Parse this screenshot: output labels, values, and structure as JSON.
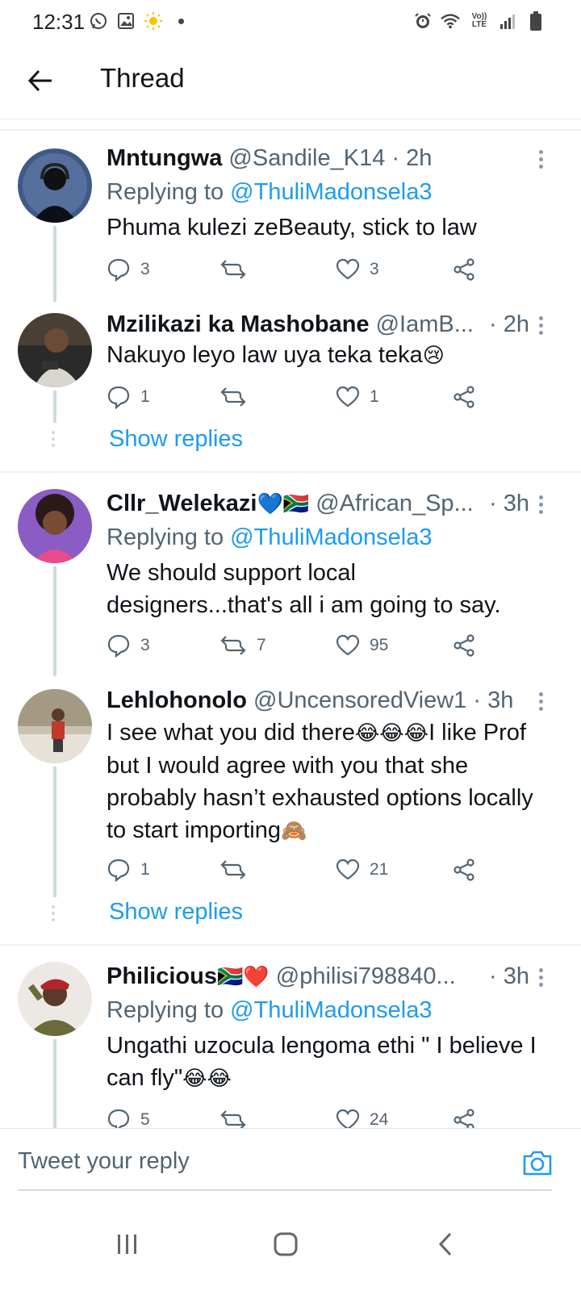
{
  "status_bar": {
    "time": "12:31",
    "lte_label": "Vo)) LTE"
  },
  "header": {
    "title": "Thread"
  },
  "tweets": [
    {
      "name": "Mntungwa",
      "handle": "@Sandile_K14",
      "time": "· 2h",
      "replying_label": "Replying to",
      "replying_to": "@ThuliMadonsela3",
      "text": "Phuma kulezi zeBeauty, stick to law",
      "replies": "3",
      "retweets": "",
      "likes": "3"
    },
    {
      "name": "Mzilikazi ka Mashobane",
      "handle": "@IamB...",
      "time": "· 2h",
      "text": "Nakuyo leyo law uya teka teka",
      "emoji": "😢",
      "replies": "1",
      "retweets": "",
      "likes": "1",
      "show_replies": "Show replies"
    },
    {
      "name": "Cllr_Welekazi",
      "name_emoji": "💙🇿🇦",
      "handle": "@African_Sp...",
      "time": "· 3h",
      "replying_label": "Replying to",
      "replying_to": "@ThuliMadonsela3",
      "text": "We should support local designers...that's all i am going to say.",
      "replies": "3",
      "retweets": "7",
      "likes": "95"
    },
    {
      "name": "Lehlohonolo",
      "handle": "@UncensoredView1",
      "time": "· 3h",
      "text_part1": "I see what you did there",
      "emoji1": "😂😂😂",
      "text_part2": "I like Prof but I would agree with you that she probably hasn’t exhausted options locally to start importing",
      "emoji2": "🙈",
      "replies": "1",
      "retweets": "",
      "likes": "21",
      "show_replies": "Show replies"
    },
    {
      "name": "Philicious",
      "name_emoji": "🇿🇦❤️",
      "handle": "@philisi798840...",
      "time": "· 3h",
      "replying_label": "Replying to",
      "replying_to": "@ThuliMadonsela3",
      "text": "Ungathi uzocula lengoma ethi \" I believe I can fly\"",
      "emoji": "😂😂",
      "replies": "5",
      "retweets": "",
      "likes": "24"
    }
  ],
  "composer": {
    "placeholder": "Tweet your reply"
  },
  "colors": {
    "accent": "#1d9bf0",
    "text": "#0f1419",
    "secondary": "#536471",
    "thread_line": "#cfd9de"
  }
}
